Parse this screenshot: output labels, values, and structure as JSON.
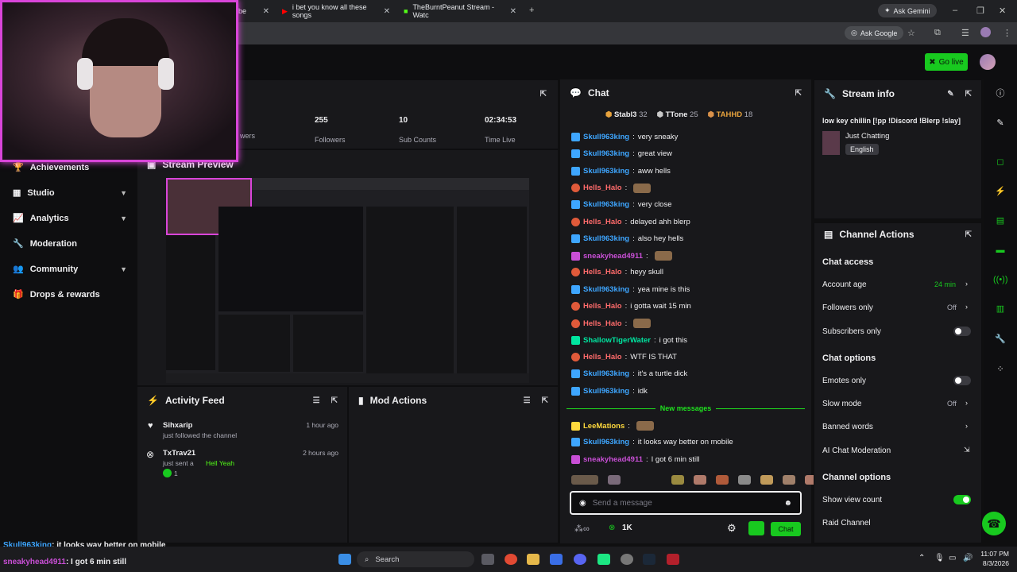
{
  "browser": {
    "tabs": [
      {
        "title": "be"
      },
      {
        "title": "i bet you know all these songs"
      },
      {
        "title": "TheBurntPeanut Stream - Watc"
      }
    ],
    "ask_gemini": "Ask Gemini",
    "ask_google": "Ask Google"
  },
  "header": {
    "go_live": "Go live"
  },
  "sidebar": {
    "items": [
      {
        "label": "Achievements",
        "has_chevron": false
      },
      {
        "label": "Studio",
        "has_chevron": true
      },
      {
        "label": "Analytics",
        "has_chevron": true
      },
      {
        "label": "Moderation",
        "has_chevron": false
      },
      {
        "label": "Community",
        "has_chevron": true
      },
      {
        "label": "Drops & rewards",
        "has_chevron": false
      }
    ]
  },
  "stats": [
    {
      "value": "",
      "label": "wers"
    },
    {
      "value": "255",
      "label": "Followers"
    },
    {
      "value": "10",
      "label": "Sub Counts"
    },
    {
      "value": "02:34:53",
      "label": "Time Live"
    }
  ],
  "stream_preview": {
    "title": "Stream Preview"
  },
  "activity_feed": {
    "title": "Activity Feed",
    "items": [
      {
        "user": "Sihxarip",
        "time": "1 hour ago",
        "text": "just followed the channel",
        "extra": ""
      },
      {
        "user": "TxTrav21",
        "time": "2 hours ago",
        "text": "just sent a",
        "extra": "Hell Yeah",
        "count": "1"
      }
    ]
  },
  "mod_actions": {
    "title": "Mod Actions"
  },
  "chat": {
    "title": "Chat",
    "leaders": [
      {
        "name": "Stabl3",
        "count": "32",
        "color": "#e8a33d"
      },
      {
        "name": "TTone",
        "count": "25",
        "color": "#c9c9c9"
      },
      {
        "name": "TAHHD",
        "count": "18",
        "color": "#d9914a"
      }
    ],
    "messages": [
      {
        "user": "Skull963king",
        "color": "#3ea6ff",
        "text": "very sneaky"
      },
      {
        "user": "Skull963king",
        "color": "#3ea6ff",
        "text": "great view"
      },
      {
        "user": "Skull963king",
        "color": "#3ea6ff",
        "text": "aww hells"
      },
      {
        "user": "Hells_Halo",
        "color": "#ff6b6b",
        "text": ""
      },
      {
        "user": "Skull963king",
        "color": "#3ea6ff",
        "text": "very close"
      },
      {
        "user": "Hells_Halo",
        "color": "#ff6b6b",
        "text": "delayed ahh blerp"
      },
      {
        "user": "Skull963king",
        "color": "#3ea6ff",
        "text": "also hey hells"
      },
      {
        "user": "sneakyhead4911",
        "color": "#c94fd6",
        "text": ""
      },
      {
        "user": "Hells_Halo",
        "color": "#ff6b6b",
        "text": "heyy skull"
      },
      {
        "user": "Skull963king",
        "color": "#3ea6ff",
        "text": "yea mine is this"
      },
      {
        "user": "Hells_Halo",
        "color": "#ff6b6b",
        "text": "i gotta wait 15 min"
      },
      {
        "user": "Hells_Halo",
        "color": "#ff6b6b",
        "text": ""
      },
      {
        "user": "ShallowTigerWater",
        "color": "#00e5a0",
        "text": "i got this"
      },
      {
        "user": "Hells_Halo",
        "color": "#ff6b6b",
        "text": "WTF IS THAT"
      },
      {
        "user": "Skull963king",
        "color": "#3ea6ff",
        "text": "it's a turtle dick"
      },
      {
        "user": "Skull963king",
        "color": "#3ea6ff",
        "text": "idk"
      }
    ],
    "new_messages_label": "New messages",
    "new_messages": [
      {
        "user": "LeeMations",
        "color": "#ffd93d",
        "text": ""
      },
      {
        "user": "Skull963king",
        "color": "#3ea6ff",
        "text": "it looks way better on mobile"
      },
      {
        "user": "sneakyhead4911",
        "color": "#c94fd6",
        "text": "I got 6 min still"
      }
    ],
    "input_placeholder": "Send a message",
    "points": "1K",
    "chat_button": "Chat"
  },
  "stream_info": {
    "title": "Stream info",
    "stream_title": "low key chillin [!pp !Discord !Blerp !slay]",
    "category": "Just Chatting",
    "language": "English"
  },
  "channel_actions": {
    "title": "Channel Actions",
    "chat_access": "Chat access",
    "account_age": {
      "label": "Account age",
      "value": "24 min"
    },
    "followers_only": {
      "label": "Followers only",
      "value": "Off"
    },
    "subscribers_only": {
      "label": "Subscribers only",
      "on": false
    },
    "chat_options": "Chat options",
    "emotes_only": {
      "label": "Emotes only",
      "on": false
    },
    "slow_mode": {
      "label": "Slow mode",
      "value": "Off"
    },
    "banned_words": "Banned words",
    "ai_moderation": "AI Chat Moderation",
    "channel_options": "Channel options",
    "show_view_count": {
      "label": "Show view count",
      "on": true
    },
    "raid_channel": "Raid Channel"
  },
  "overlay_chat": [
    {
      "user": "Skull963king",
      "text": ": it looks way better on mobile"
    },
    {
      "user": "sneakyhead4911",
      "text": ": I got 6 min still"
    }
  ],
  "taskbar": {
    "search": "Search",
    "time": "11:07 PM",
    "date": "8/3/2026"
  },
  "colors": {
    "accent": "#18c91f",
    "panel": "#18181b",
    "bg": "#0e0e10"
  }
}
